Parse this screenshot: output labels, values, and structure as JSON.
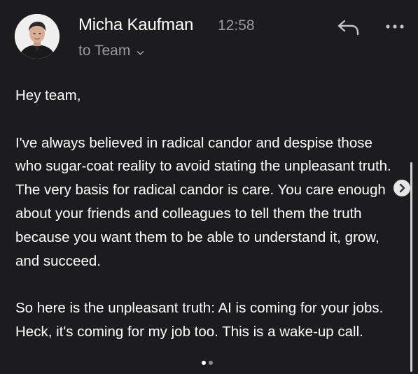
{
  "email": {
    "sender_name": "Micha Kaufman",
    "time": "12:58",
    "recipient": "to Team",
    "paragraphs": [
      "Hey team,",
      "I've always believed in radical candor and despise those who sugar-coat reality to avoid stating the unpleasant truth. The very basis for radical candor is care. You care enough about your friends and colleagues to tell them the truth because you want them to be able to understand it, grow, and succeed.",
      "So here is the unpleasant truth: AI is coming for your jobs. Heck, it's coming for my job too. This is a wake-up call."
    ]
  },
  "icons": {
    "avatar": "avatar-photo",
    "recipient_dropdown": "chevron-down-icon",
    "reply": "reply-icon",
    "more": "more-horizontal-icon",
    "next": "chevron-right-icon"
  },
  "carousel": {
    "current_page": 1,
    "total_pages": 2
  },
  "colors": {
    "background": "#1c1c1e",
    "primary_text": "#ffffff",
    "secondary_text": "#9a9a9e"
  }
}
